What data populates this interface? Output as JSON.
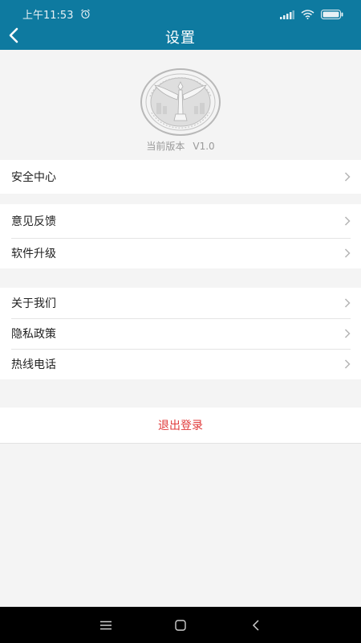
{
  "status_bar": {
    "time": "上午11:53",
    "icons": [
      "alarm-icon",
      "signal-icon",
      "wifi-icon",
      "battery-icon"
    ]
  },
  "header": {
    "title": "设置",
    "back_icon": "chevron-left-icon",
    "color": "#0e7aa0"
  },
  "about": {
    "logo_icon": "emblem-logo",
    "version_label": "当前版本",
    "version_value": "V1.0"
  },
  "groups": [
    {
      "items": [
        {
          "label": "安全中心"
        }
      ]
    },
    {
      "items": [
        {
          "label": "意见反馈"
        },
        {
          "label": "软件升级"
        }
      ]
    },
    {
      "items": [
        {
          "label": "关于我们"
        },
        {
          "label": "隐私政策"
        },
        {
          "label": "热线电话"
        }
      ]
    }
  ],
  "logout": {
    "label": "退出登录",
    "color": "#e03a3a"
  },
  "nav_bar": {
    "icons": [
      "menu-icon",
      "home-icon",
      "back-icon"
    ]
  }
}
